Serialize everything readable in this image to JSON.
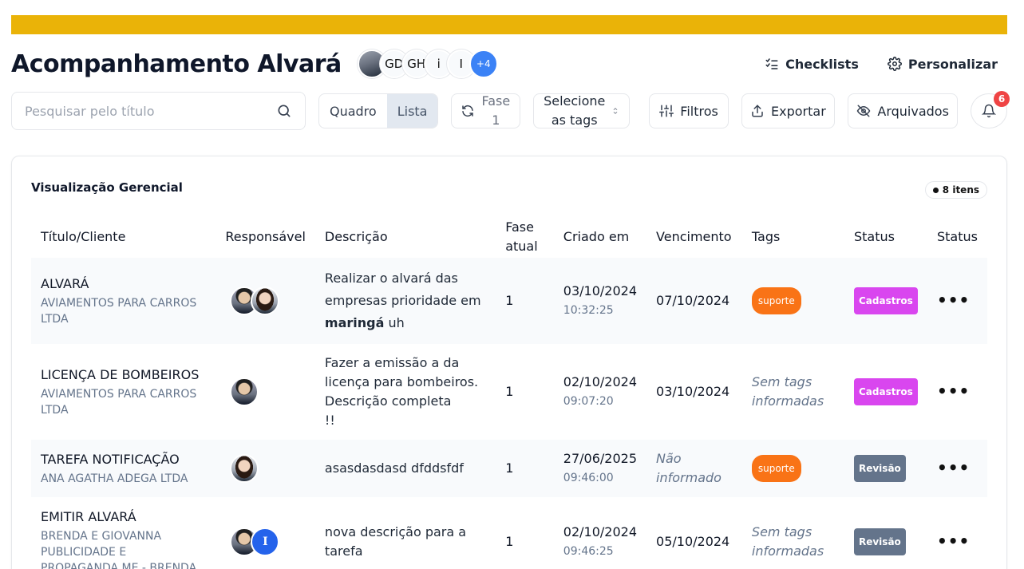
{
  "header": {
    "title": "Acompanhamento Alvará",
    "members": [
      "GD",
      "GH",
      "i",
      "I"
    ],
    "members_more": "+4",
    "checklists_label": "Checklists",
    "customize_label": "Personalizar"
  },
  "toolbar": {
    "search_placeholder": "Pesquisar pelo título",
    "view_board": "Quadro",
    "view_list": "Lista",
    "active_view": "Lista",
    "phase_label": "Fase",
    "phase_value": "1",
    "tags_label_1": "Selecione",
    "tags_label_2": "as tags",
    "filters_label": "Filtros",
    "export_label": "Exportar",
    "archived_label": "Arquivados",
    "notifications_count": "6"
  },
  "table": {
    "title": "Visualização Gerencial",
    "items_count": "8 itens",
    "columns": [
      "Título/Cliente",
      "Responsável",
      "Descrição",
      "Fase atual",
      "Criado em",
      "Vencimento",
      "Tags",
      "Status",
      "Status"
    ],
    "rows": [
      {
        "title": "ALVARÁ",
        "client": "AVIAMENTOS PARA CARROS LTDA",
        "description_pre": "Realizar o alvará das empresas prioridade em ",
        "description_bold": "maringá",
        "description_post": " uh",
        "phase": "1",
        "created_date": "03/10/2024",
        "created_time": "10:32:25",
        "due": "07/10/2024",
        "tag": "suporte",
        "status": "Cadastros",
        "status_color": "#d946ef"
      },
      {
        "title": "LICENÇA DE BOMBEIROS",
        "client": "AVIAMENTOS PARA CARROS LTDA",
        "description_line1": "Fazer a emissão a da licença para bombeiros.",
        "description_line2": "Descrição completa",
        "description_line3": "!!",
        "phase": "1",
        "created_date": "02/10/2024",
        "created_time": "09:07:20",
        "due": "03/10/2024",
        "tag_empty": "Sem tags informadas",
        "status": "Cadastros",
        "status_color": "#d946ef"
      },
      {
        "title": "TAREFA NOTIFICAÇÃO",
        "client": "ANA AGATHA ADEGA LTDA",
        "description": "asasdasdasd dfddsfdf",
        "phase": "1",
        "created_date": "27/06/2025",
        "created_time": "09:46:00",
        "due_empty": "Não informado",
        "tag": "suporte",
        "status": "Revisão",
        "status_color": "#64748b"
      },
      {
        "title": "EMITIR ALVARÁ",
        "client": "BRENDA E GIOVANNA PUBLICIDADE E PROPAGANDA ME - BRENDA",
        "description": "nova descrição para a tarefa",
        "phase": "1",
        "created_date": "02/10/2024",
        "created_time": "09:46:25",
        "due": "05/10/2024",
        "tag_empty": "Sem tags informadas",
        "avatar_letter": "I",
        "status": "Revisão",
        "status_color": "#64748b"
      }
    ],
    "more_actions": "•••"
  },
  "colors": {
    "topbar": "#eab308",
    "more_avatar": "#3b82f6",
    "tag": "#f97316",
    "badge": "#ef4444"
  }
}
